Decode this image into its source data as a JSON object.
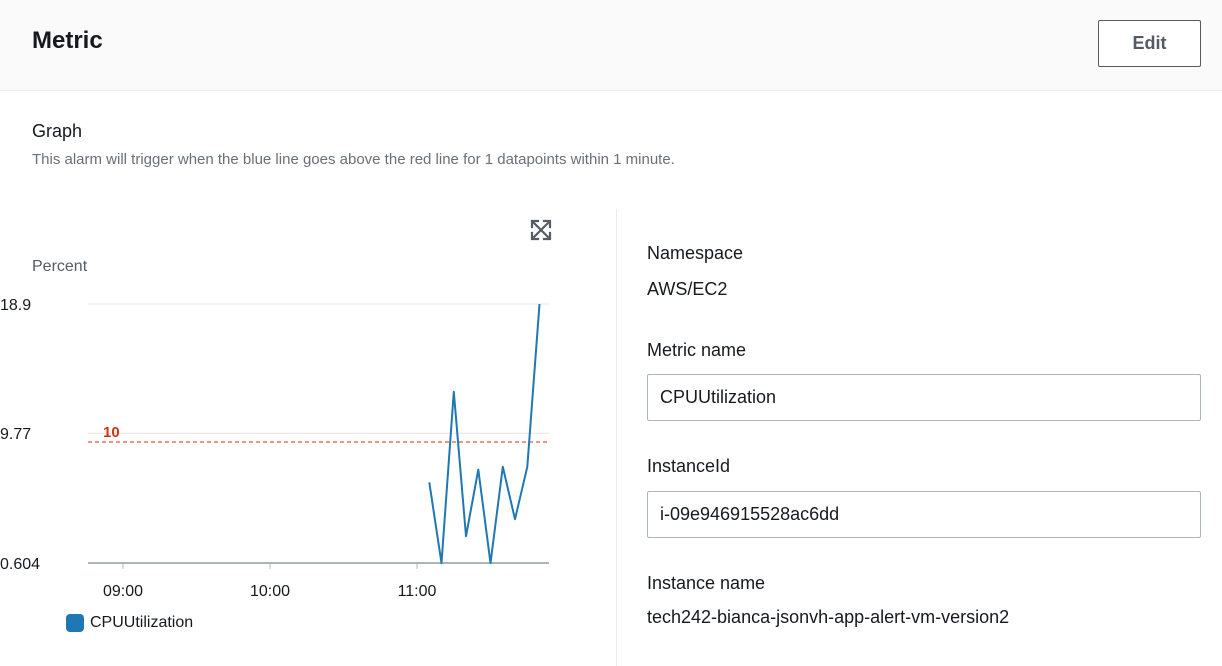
{
  "header": {
    "title": "Metric",
    "edit_label": "Edit"
  },
  "graph": {
    "label": "Graph",
    "description": "This alarm will trigger when the blue line goes above the red line for 1 datapoints within 1 minute."
  },
  "chart_data": {
    "type": "line",
    "ylabel": "Percent",
    "y_ticks": [
      "18.9",
      "9.77",
      "0.604"
    ],
    "y_tick_values": [
      18.9,
      9.77,
      0.604
    ],
    "x_ticks": [
      "09:00",
      "10:00",
      "11:00"
    ],
    "ylim": [
      0.604,
      18.9
    ],
    "threshold": {
      "label": "10",
      "value": 10,
      "color": "#d13212"
    },
    "series": [
      {
        "name": "CPUUtilization",
        "color": "#1f77b4",
        "x": [
          "11:05",
          "11:10",
          "11:15",
          "11:20",
          "11:25",
          "11:30",
          "11:35",
          "11:40",
          "11:45",
          "11:50"
        ],
        "y": [
          6.3,
          0.6,
          12.7,
          2.5,
          7.2,
          0.6,
          7.4,
          3.7,
          7.4,
          18.9
        ]
      }
    ],
    "legend": [
      "CPUUtilization"
    ],
    "grid": true
  },
  "details": {
    "namespace_label": "Namespace",
    "namespace_value": "AWS/EC2",
    "metric_name_label": "Metric name",
    "metric_name_value": "CPUUtilization",
    "instance_id_label": "InstanceId",
    "instance_id_value": "i-09e946915528ac6dd",
    "instance_name_label": "Instance name",
    "instance_name_value": "tech242-bianca-jsonvh-app-alert-vm-version2"
  },
  "icons": {
    "expand": "expand-icon"
  }
}
